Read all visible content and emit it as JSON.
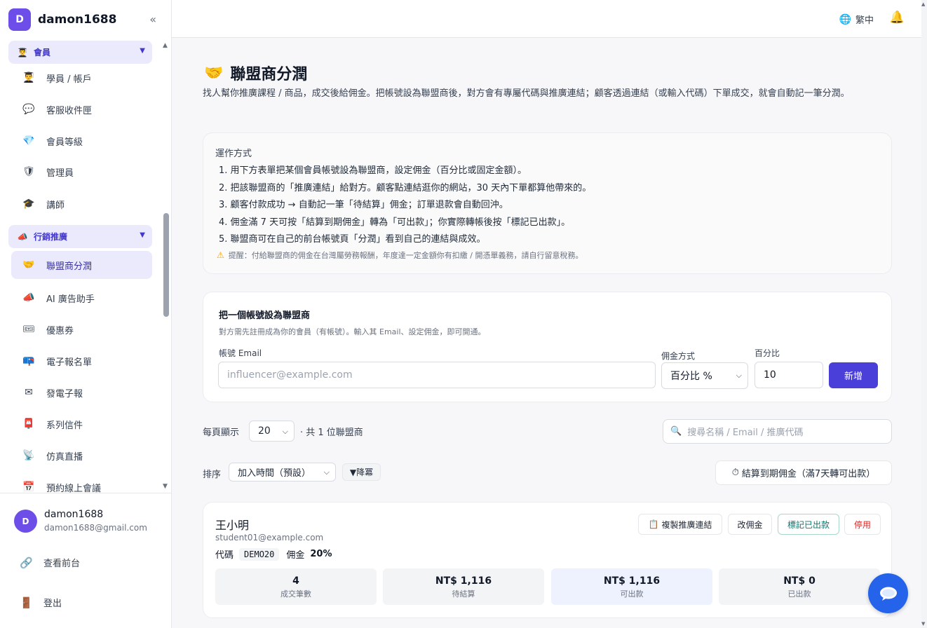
{
  "sidebar": {
    "logo_letter": "D",
    "brand": "damon1688",
    "collapse_icon": "«",
    "groups": {
      "member": {
        "label": "會員",
        "caret": "▼"
      },
      "marketing": {
        "label": "行銷推廣",
        "caret": "▼"
      }
    },
    "member_items": [
      {
        "label": "學員 / 帳戶",
        "icon": "student-icon"
      },
      {
        "label": "客服收件匣",
        "icon": "chat-bubble-icon"
      },
      {
        "label": "會員等級",
        "icon": "diamond-icon"
      },
      {
        "label": "管理員",
        "icon": "shield-icon"
      },
      {
        "label": "講師",
        "icon": "graduation-cap-icon"
      }
    ],
    "marketing_items": [
      {
        "label": "聯盟商分潤",
        "icon": "handshake-icon",
        "active": true
      },
      {
        "label": "AI 廣告助手",
        "icon": "megaphone-icon"
      },
      {
        "label": "優惠券",
        "icon": "ticket-icon"
      },
      {
        "label": "電子報名單",
        "icon": "mailbox-icon"
      },
      {
        "label": "發電子報",
        "icon": "envelope-icon"
      },
      {
        "label": "系列信件",
        "icon": "postbox-icon"
      },
      {
        "label": "仿真直播",
        "icon": "satellite-icon"
      },
      {
        "label": "預約線上會議",
        "icon": "calendar-icon"
      }
    ],
    "user": {
      "avatar_letter": "D",
      "name": "damon1688",
      "email": "damon1688@gmail.com"
    },
    "footer_links": {
      "frontend": "查看前台",
      "logout": "登出"
    }
  },
  "topbar": {
    "language": "繁中"
  },
  "page": {
    "title": "聯盟商分潤",
    "description": "找人幫你推廣課程 / 商品，成交後給佣金。把帳號設為聯盟商後，對方會有專屬代碼與推廣連結；顧客透過連結（或輸入代碼）下單成交，就會自動記一筆分潤。"
  },
  "how_it_works": {
    "title": "運作方式",
    "steps": [
      "1. 用下方表單把某個會員帳號設為聯盟商，設定佣金（百分比或固定金額）。",
      "2. 把該聯盟商的「推廣連結」給對方。顧客點連結逛你的網站，30 天內下單都算他帶來的。",
      "3. 顧客付款成功 → 自動記一筆「待結算」佣金；訂單退款會自動回沖。",
      "4. 佣金滿 7 天可按「結算到期佣金」轉為「可出款」；你實際轉帳後按「標記已出款」。",
      "5. 聯盟商可在自己的前台帳號頁「分潤」看到自己的連結與成效。"
    ],
    "warning": "提醒：付給聯盟商的佣金在台灣屬勞務報酬，年度達一定金額你有扣繳 / 開憑單義務，請自行留意稅務。"
  },
  "add_form": {
    "title": "把一個帳號設為聯盟商",
    "subtitle": "對方需先註冊成為你的會員（有帳號）。輸入其 Email、設定佣金，即可開通。",
    "email_label": "帳號 Email",
    "email_placeholder": "influencer@example.com",
    "commission_type_label": "佣金方式",
    "commission_type_value": "百分比 %",
    "percent_label": "百分比",
    "percent_value": "10",
    "submit_label": "新增"
  },
  "list_controls": {
    "per_page_label": "每頁顯示",
    "per_page_value": "20",
    "total_text": "· 共 1 位聯盟商",
    "search_placeholder": "搜尋名稱 / Email / 推廣代碼",
    "sort_label": "排序",
    "sort_value": "加入時間（預設）",
    "order_label": "▼降冪",
    "settle_button": "結算到期佣金（滿7天轉可出款）"
  },
  "affiliates": [
    {
      "name": "王小明",
      "email": "student01@example.com",
      "code_label": "代碼",
      "code": "DEMO20",
      "commission_label": "佣金",
      "commission": "20%",
      "actions": {
        "copy_link": "複製推廣連結",
        "edit_commission": "改佣金",
        "mark_paid": "標記已出款",
        "disable": "停用"
      },
      "stats": [
        {
          "value": "4",
          "label": "成交筆數"
        },
        {
          "value": "NT$ 1,116",
          "label": "待結算"
        },
        {
          "value": "NT$ 1,116",
          "label": "可出款"
        },
        {
          "value": "NT$ 0",
          "label": "已出款"
        }
      ]
    }
  ],
  "colors": {
    "accent": "#4a3fd9",
    "brand": "#6d4ee8",
    "active_bg": "#ebeafc",
    "chat": "#2563eb"
  }
}
